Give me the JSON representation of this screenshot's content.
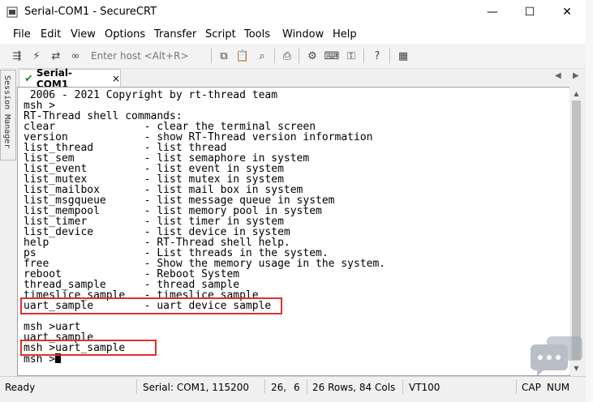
{
  "window": {
    "title": "Serial-COM1 - SecureCRT",
    "minimize": "—",
    "maximize": "☐",
    "close": "✕"
  },
  "menu": [
    "File",
    "Edit",
    "View",
    "Options",
    "Transfer",
    "Script",
    "Tools",
    "Window",
    "Help"
  ],
  "toolbar": {
    "host_placeholder": "Enter host <Alt+R>"
  },
  "side_panel": {
    "label": "Session Manager"
  },
  "tab": {
    "label": "Serial-COM1",
    "close": "×"
  },
  "terminal": {
    "lines": [
      " 2006 - 2021 Copyright by rt-thread team",
      "msh >",
      "RT-Thread shell commands:",
      "clear              - clear the terminal screen",
      "version            - show RT-Thread version information",
      "list_thread        - list thread",
      "list_sem           - list semaphore in system",
      "list_event         - list event in system",
      "list_mutex         - list mutex in system",
      "list_mailbox       - list mail box in system",
      "list_msgqueue      - list message queue in system",
      "list_mempool       - list memory pool in system",
      "list_timer         - list timer in system",
      "list_device        - list device in system",
      "help               - RT-Thread shell help.",
      "ps                 - List threads in the system.",
      "free               - Show the memory usage in the system.",
      "reboot             - Reboot System",
      "thread_sample      - thread sample",
      "timeslice_sample   - timeslice sample",
      "uart_sample        - uart device sample",
      "",
      "msh >uart",
      "uart_sample",
      "msh >uart_sample",
      "msh >"
    ]
  },
  "status": {
    "ready": "Ready",
    "connection": "Serial: COM1, 115200",
    "row": "26,",
    "col": "6",
    "size": "26 Rows, 84 Cols",
    "emulation": "VT100",
    "cap": "CAP",
    "num": "NUM"
  },
  "colors": {
    "highlight": "#e03030",
    "tab_check": "#2e8b2e"
  },
  "icons": [
    "connect-icon",
    "lightning-icon",
    "reconnect-icon",
    "link-icon",
    "copy-icon",
    "paste-icon",
    "find-icon",
    "print-icon",
    "settings-icon",
    "keymap-icon",
    "key-icon",
    "help-icon",
    "script-icon"
  ]
}
